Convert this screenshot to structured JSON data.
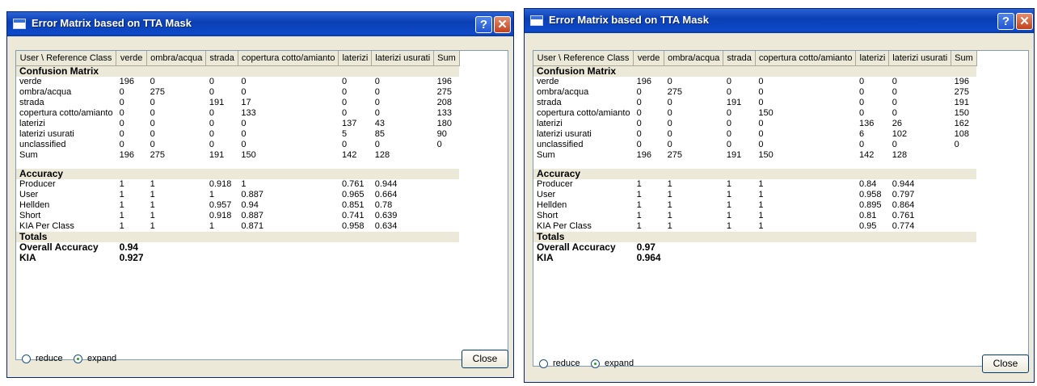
{
  "headers": [
    "User \\ Reference Class",
    "verde",
    "ombra/acqua",
    "strada",
    "copertura cotto/amianto",
    "laterizi",
    "laterizi usurati",
    "Sum"
  ],
  "colors": {
    "title_bar": "#0b3fb3",
    "header_bg": "#ece9d8",
    "close_red": "#c2421d"
  },
  "dialogs": [
    {
      "title": "Error Matrix based on TTA Mask",
      "help_label": "?",
      "close_x": "✕",
      "sections": {
        "confusion": "Confusion Matrix",
        "accuracy": "Accuracy",
        "totals": "Totals"
      },
      "confusion_rows": [
        [
          "verde",
          "196",
          "0",
          "0",
          "0",
          "0",
          "0",
          "196"
        ],
        [
          "ombra/acqua",
          "0",
          "275",
          "0",
          "0",
          "0",
          "0",
          "275"
        ],
        [
          "strada",
          "0",
          "0",
          "191",
          "17",
          "0",
          "0",
          "208"
        ],
        [
          "copertura cotto/amianto",
          "0",
          "0",
          "0",
          "133",
          "0",
          "0",
          "133"
        ],
        [
          "laterizi",
          "0",
          "0",
          "0",
          "0",
          "137",
          "43",
          "180"
        ],
        [
          "laterizi usurati",
          "0",
          "0",
          "0",
          "0",
          "5",
          "85",
          "90"
        ],
        [
          "unclassified",
          "0",
          "0",
          "0",
          "0",
          "0",
          "0",
          "0"
        ],
        [
          "Sum",
          "196",
          "275",
          "191",
          "150",
          "142",
          "128",
          ""
        ]
      ],
      "accuracy_rows": [
        [
          "Producer",
          "1",
          "1",
          "0.918",
          "1",
          "0.761",
          "0.944",
          ""
        ],
        [
          "User",
          "1",
          "1",
          "1",
          "0.887",
          "0.965",
          "0.664",
          ""
        ],
        [
          "Hellden",
          "1",
          "1",
          "0.957",
          "0.94",
          "0.851",
          "0.78",
          ""
        ],
        [
          "Short",
          "1",
          "1",
          "0.918",
          "0.887",
          "0.741",
          "0.639",
          ""
        ],
        [
          "KIA Per Class",
          "1",
          "1",
          "1",
          "0.871",
          "0.958",
          "0.634",
          ""
        ]
      ],
      "totals_rows": [
        [
          "Overall Accuracy",
          "0.94"
        ],
        [
          "KIA",
          "0.927"
        ]
      ],
      "radio_reduce": "reduce",
      "radio_expand": "expand",
      "selected_radio": "expand",
      "close_label": "Close"
    },
    {
      "title": "Error Matrix based on TTA Mask",
      "help_label": "?",
      "close_x": "✕",
      "sections": {
        "confusion": "Confusion Matrix",
        "accuracy": "Accuracy",
        "totals": "Totals"
      },
      "confusion_rows": [
        [
          "verde",
          "196",
          "0",
          "0",
          "0",
          "0",
          "0",
          "196"
        ],
        [
          "ombra/acqua",
          "0",
          "275",
          "0",
          "0",
          "0",
          "0",
          "275"
        ],
        [
          "strada",
          "0",
          "0",
          "191",
          "0",
          "0",
          "0",
          "191"
        ],
        [
          "copertura cotto/amianto",
          "0",
          "0",
          "0",
          "150",
          "0",
          "0",
          "150"
        ],
        [
          "laterizi",
          "0",
          "0",
          "0",
          "0",
          "136",
          "26",
          "162"
        ],
        [
          "laterizi usurati",
          "0",
          "0",
          "0",
          "0",
          "6",
          "102",
          "108"
        ],
        [
          "unclassified",
          "0",
          "0",
          "0",
          "0",
          "0",
          "0",
          "0"
        ],
        [
          "Sum",
          "196",
          "275",
          "191",
          "150",
          "142",
          "128",
          ""
        ]
      ],
      "accuracy_rows": [
        [
          "Producer",
          "1",
          "1",
          "1",
          "1",
          "0.84",
          "0.944",
          ""
        ],
        [
          "User",
          "1",
          "1",
          "1",
          "1",
          "0.958",
          "0.797",
          ""
        ],
        [
          "Hellden",
          "1",
          "1",
          "1",
          "1",
          "0.895",
          "0.864",
          ""
        ],
        [
          "Short",
          "1",
          "1",
          "1",
          "1",
          "0.81",
          "0.761",
          ""
        ],
        [
          "KIA Per Class",
          "1",
          "1",
          "1",
          "1",
          "0.95",
          "0.774",
          ""
        ]
      ],
      "totals_rows": [
        [
          "Overall Accuracy",
          "0.97"
        ],
        [
          "KIA",
          "0.964"
        ]
      ],
      "radio_reduce": "reduce",
      "radio_expand": "expand",
      "selected_radio": "expand",
      "close_label": "Close"
    }
  ]
}
